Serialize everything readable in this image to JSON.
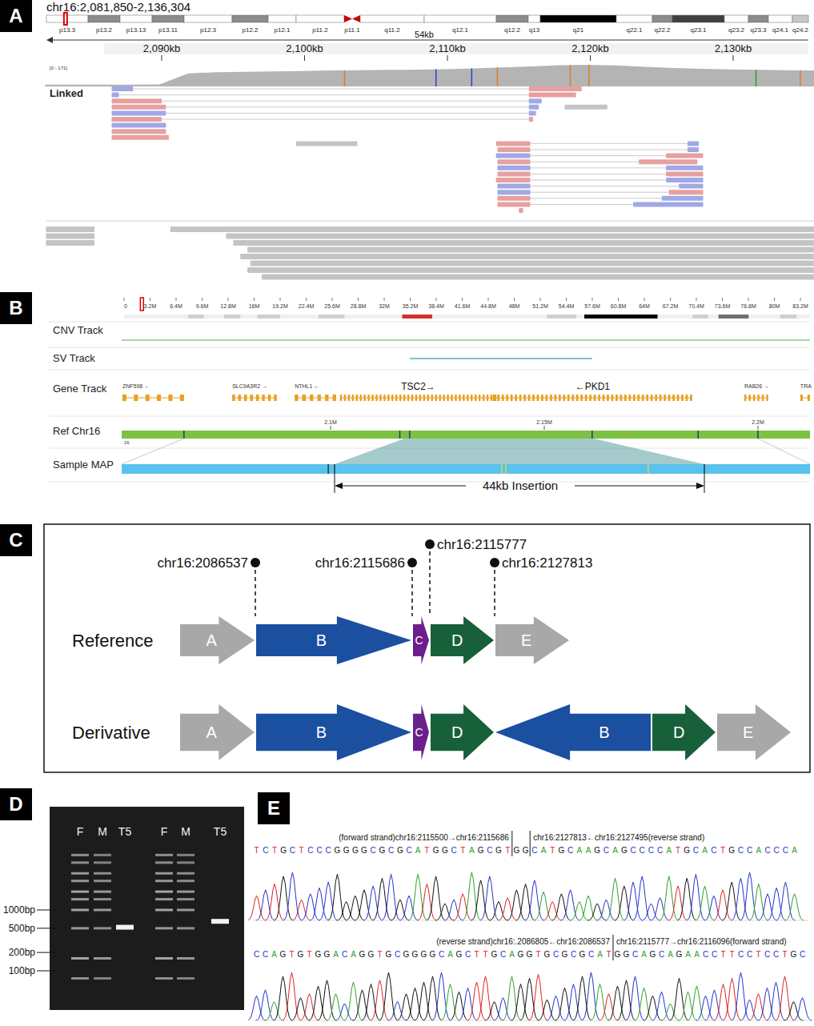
{
  "panelA": {
    "label": "A",
    "locus": "chr16:2,081,850-2,136,304",
    "cytobands": [
      {
        "label": "p13.3",
        "size": 52,
        "color": "#ffffff",
        "current": true,
        "centromere": false
      },
      {
        "label": "p13.2",
        "size": 40,
        "color": "#8c8c8c",
        "current": false,
        "centromere": false
      },
      {
        "label": "p13.13",
        "size": 40,
        "color": "#ffffff",
        "current": false,
        "centromere": false
      },
      {
        "label": "p13.11",
        "size": 40,
        "color": "#8c8c8c",
        "current": false,
        "centromere": false
      },
      {
        "label": "p12.3",
        "size": 60,
        "color": "#ffffff",
        "current": false,
        "centromere": false
      },
      {
        "label": "p12.2",
        "size": 45,
        "color": "#8c8c8c",
        "current": false,
        "centromere": false
      },
      {
        "label": "p12.1",
        "size": 35,
        "color": "#ffffff",
        "current": false,
        "centromere": false
      },
      {
        "label": "p11.2",
        "size": 60,
        "color": "#ffffff",
        "current": false,
        "centromere": false
      },
      {
        "label": "p11.1",
        "size": 20,
        "color": "#cc0000",
        "current": false,
        "centromere": true
      },
      {
        "label": "q11.2",
        "size": 80,
        "color": "#ffffff",
        "current": false,
        "centromere": false
      },
      {
        "label": "q12.1",
        "size": 90,
        "color": "#ffffff",
        "current": false,
        "centromere": false
      },
      {
        "label": "q12.2",
        "size": 40,
        "color": "#8c8c8c",
        "current": false,
        "centromere": false
      },
      {
        "label": "q13",
        "size": 15,
        "color": "#ffffff",
        "current": false,
        "centromere": false
      },
      {
        "label": "q21",
        "size": 95,
        "color": "#000000",
        "current": false,
        "centromere": false
      },
      {
        "label": "q22.1",
        "size": 45,
        "color": "#ffffff",
        "current": false,
        "centromere": false
      },
      {
        "label": "q22.2",
        "size": 25,
        "color": "#8c8c8c",
        "current": false,
        "centromere": false
      },
      {
        "label": "q23.1",
        "size": 65,
        "color": "#404040",
        "current": false,
        "centromere": false
      },
      {
        "label": "q23.2",
        "size": 30,
        "color": "#ffffff",
        "current": false,
        "centromere": false
      },
      {
        "label": "q23.3",
        "size": 25,
        "color": "#8c8c8c",
        "current": false,
        "centromere": false
      },
      {
        "label": "q24.1",
        "size": 30,
        "color": "#ffffff",
        "current": false,
        "centromere": false
      },
      {
        "label": "q24.2",
        "size": 20,
        "color": "#c8c8c8",
        "current": false,
        "centromere": false
      }
    ],
    "span": "54kb",
    "ticks": [
      {
        "label": "2,090kb",
        "kb": 2090
      },
      {
        "label": "2,100kb",
        "kb": 2100
      },
      {
        "label": "2,110kb",
        "kb": 2110
      },
      {
        "label": "2,120kb",
        "kb": 2120
      },
      {
        "label": "2,130kb",
        "kb": 2130
      }
    ],
    "coverage_range": "[0 - 171]",
    "coverage_max": 171,
    "coverage_start_kb": 2081.85,
    "coverage_step_kb": 2,
    "coverage": [
      14,
      14,
      14,
      14,
      16,
      100,
      108,
      112,
      115,
      118,
      122,
      124,
      126,
      128,
      132,
      138,
      145,
      152,
      162,
      165,
      160,
      150,
      140,
      135,
      130,
      126,
      124,
      122
    ],
    "coverage_marks": [
      {
        "kb": 2102.8,
        "color": "#e07b28"
      },
      {
        "kb": 2109.2,
        "color": "#2c3fd0"
      },
      {
        "kb": 2111.7,
        "color": "#2c3fd0"
      },
      {
        "kb": 2113.5,
        "color": "#e07b28"
      },
      {
        "kb": 2118.6,
        "color": "#e07b28"
      },
      {
        "kb": 2119.9,
        "color": "#e07b28"
      },
      {
        "kb": 2131.6,
        "color": "#2ca02c"
      },
      {
        "kb": 2134.7,
        "color": "#e07b28"
      }
    ],
    "linked_label": "Linked",
    "linked_rows": [
      {
        "linked": true,
        "reads": [
          [
            2086.5,
            2088.0,
            "#a0a8e6"
          ],
          [
            2115.7,
            2119.4,
            "#e6a0a0"
          ]
        ]
      },
      {
        "linked": true,
        "reads": [
          [
            2086.5,
            2087.0,
            "#a0a8e6"
          ],
          [
            2115.7,
            2119.0,
            "#e6a0a0"
          ]
        ]
      },
      {
        "linked": true,
        "reads": [
          [
            2086.5,
            2090.0,
            "#e6a0a0"
          ],
          [
            2115.7,
            2116.6,
            "#a0a8e6"
          ]
        ]
      },
      {
        "linked": true,
        "reads": [
          [
            2086.5,
            2090.3,
            "#e6a0a0"
          ],
          [
            2115.7,
            2116.4,
            "#a0a8e6"
          ],
          [
            2118.2,
            2121.2,
            "#c4c4c4"
          ]
        ]
      },
      {
        "linked": true,
        "reads": [
          [
            2086.5,
            2090.3,
            "#a0a8e6"
          ],
          [
            2115.7,
            2116.2,
            "#a0a8e6"
          ]
        ]
      },
      {
        "linked": true,
        "reads": [
          [
            2086.5,
            2090.0,
            "#e6a0a0"
          ],
          [
            2115.7,
            2116.0,
            "#e6a0a0"
          ]
        ]
      },
      {
        "linked": false,
        "reads": [
          [
            2086.5,
            2090.3,
            "#a0a8e6"
          ]
        ]
      },
      {
        "linked": false,
        "reads": [
          [
            2086.5,
            2090.3,
            "#e6a0a0"
          ]
        ]
      },
      {
        "linked": false,
        "reads": [
          [
            2086.5,
            2090.5,
            "#e6a0a0"
          ]
        ]
      },
      {
        "linked": true,
        "reads": [
          [
            2113.4,
            2115.8,
            "#e6a0a0"
          ],
          [
            2126.8,
            2127.6,
            "#a0a8e6"
          ],
          [
            2099.4,
            2103.7,
            "#c4c4c4"
          ]
        ]
      },
      {
        "linked": true,
        "reads": [
          [
            2113.5,
            2115.8,
            "#e6a0a0"
          ],
          [
            2126.8,
            2127.6,
            "#a0a8e6"
          ]
        ]
      },
      {
        "linked": true,
        "reads": [
          [
            2113.4,
            2115.8,
            "#a0a8e6"
          ],
          [
            2125.3,
            2127.9,
            "#e6a0a0"
          ]
        ]
      },
      {
        "linked": true,
        "reads": [
          [
            2113.5,
            2115.8,
            "#e6a0a0"
          ],
          [
            2123.4,
            2127.5,
            "#e6a0a0"
          ]
        ]
      },
      {
        "linked": true,
        "reads": [
          [
            2113.5,
            2115.8,
            "#a0a8e6"
          ],
          [
            2125.3,
            2127.9,
            "#a0a8e6"
          ]
        ]
      },
      {
        "linked": true,
        "reads": [
          [
            2113.5,
            2115.8,
            "#e6a0a0"
          ],
          [
            2125.3,
            2127.9,
            "#e6a0a0"
          ]
        ]
      },
      {
        "linked": true,
        "reads": [
          [
            2113.4,
            2115.8,
            "#e6a0a0"
          ],
          [
            2125.3,
            2127.9,
            "#a0a8e6"
          ]
        ]
      },
      {
        "linked": true,
        "reads": [
          [
            2113.5,
            2115.8,
            "#a0a8e6"
          ],
          [
            2126.2,
            2127.9,
            "#a0a8e6"
          ]
        ]
      },
      {
        "linked": true,
        "reads": [
          [
            2113.5,
            2115.8,
            "#a0a8e6"
          ],
          [
            2125.5,
            2127.9,
            "#e6a0a0"
          ]
        ]
      },
      {
        "linked": true,
        "reads": [
          [
            2113.5,
            2115.8,
            "#e6a0a0"
          ],
          [
            2125.0,
            2127.9,
            "#a0a8e6"
          ]
        ]
      },
      {
        "linked": true,
        "reads": [
          [
            2113.5,
            2115.8,
            "#e6a0a0"
          ],
          [
            2123.0,
            2127.9,
            "#a0a8e6"
          ]
        ]
      },
      {
        "linked": false,
        "reads": [
          [
            2115.0,
            2115.3,
            "#e6a0a0"
          ]
        ]
      }
    ],
    "other_color": "#c4c4c4",
    "other_rows": [
      [
        [
          2081.9,
          2085.3
        ],
        [
          2090.6,
          2136.3
        ]
      ],
      [
        [
          2081.9,
          2085.3
        ],
        [
          2094.5,
          2136.3
        ]
      ],
      [
        [
          2081.9,
          2085.3
        ],
        [
          2095.0,
          2136.3
        ]
      ],
      [
        [
          2096.0,
          2136.3
        ]
      ],
      [
        [
          2095.5,
          2136.3
        ]
      ],
      [
        [
          2096.2,
          2136.3
        ]
      ],
      [
        [
          2096.0,
          2136.3
        ]
      ],
      [
        [
          2097.0,
          2136.3
        ]
      ]
    ]
  },
  "panelB": {
    "label": "B",
    "ruler": [
      "0",
      "3.2M",
      "6.4M",
      "9.6M",
      "12.8M",
      "16M",
      "19.2M",
      "22.4M",
      "25.6M",
      "28.8M",
      "32M",
      "35.2M",
      "38.4M",
      "41.6M",
      "44.8M",
      "48M",
      "51.2M",
      "54.4M",
      "57.6M",
      "60.8M",
      "64M",
      "67.2M",
      "70.4M",
      "73.6M",
      "76.8M",
      "80M",
      "83.2M"
    ],
    "ruler_marker_mb": 2.0,
    "cytobands": [
      {
        "start": 7.9,
        "end": 9.8,
        "color": "#cfcfcf"
      },
      {
        "start": 12.3,
        "end": 14.3,
        "color": "#cfcfcf"
      },
      {
        "start": 16.4,
        "end": 19.2,
        "color": "#cfcfcf"
      },
      {
        "start": 23.9,
        "end": 27.1,
        "color": "#cfcfcf"
      },
      {
        "start": 34.2,
        "end": 37.9,
        "color": "#d43030"
      },
      {
        "start": 52.0,
        "end": 55.6,
        "color": "#cfcfcf"
      },
      {
        "start": 56.6,
        "end": 65.6,
        "color": "#000000"
      },
      {
        "start": 69.9,
        "end": 71.8,
        "color": "#cfcfcf"
      },
      {
        "start": 73.1,
        "end": 76.8,
        "color": "#707070"
      },
      {
        "start": 80.7,
        "end": 82.7,
        "color": "#cfcfcf"
      }
    ],
    "tracks": [
      "CNV Track",
      "SV Track",
      "Gene Track",
      "Ref Chr16",
      "Sample MAP"
    ],
    "sv": {
      "start": 2118.5,
      "end": 2161.2
    },
    "genes": [
      {
        "label": "ZNF598 ←",
        "start": 2051.3,
        "end": 2065.7,
        "exons": 6,
        "kind": "minor"
      },
      {
        "label": "SLC9A3R2 →",
        "start": 2077.0,
        "end": 2087.4,
        "exons": 8,
        "kind": "minor"
      },
      {
        "label": "NTHL1 ←",
        "start": 2091.6,
        "end": 2101.3,
        "exons": 6,
        "kind": "minor"
      },
      {
        "label": "TSC2→",
        "start": 2102.2,
        "end": 2138.8,
        "exons": 40,
        "kind": "major"
      },
      {
        "label": "←PKD1",
        "start": 2138.0,
        "end": 2184.6,
        "exons": 46,
        "kind": "major"
      },
      {
        "label": "RAB26 →",
        "start": 2196.8,
        "end": 2202.4,
        "exons": 6,
        "kind": "minor"
      },
      {
        "label": "TRA",
        "start": 2209.9,
        "end": 2212.2,
        "exons": 2,
        "kind": "minor"
      }
    ],
    "ref_ticks": [
      {
        "label": "2.1M",
        "kb": 2100
      },
      {
        "label": "2.15M",
        "kb": 2150
      },
      {
        "label": "2.2M",
        "kb": 2200
      }
    ],
    "ref_marks": [
      2065.7,
      2116.2,
      2118.5,
      2161.2,
      2186.0,
      2200.0
    ],
    "chrom": "16",
    "insertion": {
      "ref_start": 2117.2,
      "ref_end": 2161.6,
      "label": "44kb Insertion"
    },
    "sample_marks": [
      {
        "at": -0.017,
        "color": "#333333"
      },
      {
        "at": 0.0,
        "color": "#333333"
      },
      {
        "at": 0.452,
        "color": "#e8d040"
      },
      {
        "at": 0.463,
        "color": "#e8d040"
      },
      {
        "at": 0.848,
        "color": "#e8d040"
      },
      {
        "at": 1.0,
        "color": "#333333"
      }
    ]
  },
  "panelC": {
    "label": "C",
    "breakpoints": [
      "chr16:2086537",
      "chr16:2115686",
      "chr16:2115777",
      "chr16:2127813"
    ],
    "segments": [
      {
        "letter": "A",
        "color": "#a8a8a8",
        "size": 93
      },
      {
        "letter": "B",
        "color": "#1b4fa0",
        "size": 194
      },
      {
        "letter": "C",
        "color": "#6b1f8c",
        "size": 20
      },
      {
        "letter": "D",
        "color": "#17603a",
        "size": 79
      },
      {
        "letter": "E",
        "color": "#a8a8a8",
        "size": 92
      }
    ],
    "reference": {
      "label": "Reference",
      "order": [
        {
          "letter": "A",
          "reverse": false
        },
        {
          "letter": "B",
          "reverse": false
        },
        {
          "letter": "C",
          "reverse": false
        },
        {
          "letter": "D",
          "reverse": false
        },
        {
          "letter": "E",
          "reverse": false
        }
      ]
    },
    "derivative": {
      "label": "Derivative",
      "order": [
        {
          "letter": "A",
          "reverse": false
        },
        {
          "letter": "B",
          "reverse": false
        },
        {
          "letter": "C",
          "reverse": false
        },
        {
          "letter": "D",
          "reverse": false
        },
        {
          "letter": "B",
          "reverse": true
        },
        {
          "letter": "D",
          "reverse": false
        },
        {
          "letter": "E",
          "reverse": false
        }
      ]
    }
  },
  "panelD": {
    "label": "D",
    "markers": [
      {
        "label": "1000bp",
        "bp": 1000
      },
      {
        "label": "500bp",
        "bp": 500
      },
      {
        "label": "200bp",
        "bp": 200
      },
      {
        "label": "100bp",
        "bp": 100
      }
    ],
    "lanes": [
      {
        "label": "F",
        "bands": [
          [
            8000,
            0.5
          ],
          [
            6000,
            0.5
          ],
          [
            4000,
            0.55
          ],
          [
            3000,
            0.55
          ],
          [
            2000,
            0.6
          ],
          [
            1500,
            0.55
          ],
          [
            1000,
            0.6
          ],
          [
            500,
            0.55
          ],
          [
            160,
            0.6
          ],
          [
            75,
            0.5
          ]
        ]
      },
      {
        "label": "M",
        "bands": [
          [
            8000,
            0.45
          ],
          [
            6000,
            0.45
          ],
          [
            4000,
            0.5
          ],
          [
            3000,
            0.5
          ],
          [
            2000,
            0.55
          ],
          [
            1500,
            0.5
          ],
          [
            1000,
            0.55
          ],
          [
            500,
            0.5
          ],
          [
            160,
            0.55
          ],
          [
            75,
            0.45
          ]
        ]
      },
      {
        "label": "T5",
        "bands": [
          [
            520,
            0.95
          ]
        ]
      },
      {
        "label": "F",
        "bands": [
          [
            8000,
            0.5
          ],
          [
            6000,
            0.5
          ],
          [
            4000,
            0.55
          ],
          [
            3000,
            0.55
          ],
          [
            2000,
            0.6
          ],
          [
            1500,
            0.55
          ],
          [
            1000,
            0.6
          ],
          [
            500,
            0.55
          ],
          [
            160,
            0.6
          ],
          [
            75,
            0.5
          ]
        ]
      },
      {
        "label": "M",
        "bands": [
          [
            8000,
            0.45
          ],
          [
            6000,
            0.45
          ],
          [
            4000,
            0.5
          ],
          [
            3000,
            0.5
          ],
          [
            2000,
            0.55
          ],
          [
            1500,
            0.5
          ],
          [
            1000,
            0.55
          ],
          [
            500,
            0.5
          ],
          [
            160,
            0.55
          ],
          [
            75,
            0.45
          ]
        ]
      },
      {
        "label": "T5",
        "bands": [
          [
            650,
            0.95
          ]
        ]
      }
    ]
  },
  "panelE": {
    "label": "E",
    "base_colors": {
      "A": "#2ca02c",
      "C": "#2233cc",
      "G": "#111111",
      "T": "#dd2222"
    },
    "traces": [
      {
        "headers": [
          "(forward strand)chr16:2115500→chr16:2115686",
          "chr16:2127813←chr16:2127495(reverse strand)"
        ],
        "parts": [
          "TCTGCTCCCGGGGCGCGCATGGCTAGCGT",
          "GG",
          "CATGCAAGCAGCCCCATGCACTGCCACCCA"
        ]
      },
      {
        "headers": [
          "(reverse strand)chr16:.2086805←chr16:2086537",
          "chr16:2115777→chr16:2116096(forward strand)"
        ],
        "parts": [
          "CCAGTGTGGACAGGTGCGGGGCAGCTTGCAGGTGCGCGCAT",
          "GGCAGCAGAACCTTCCTCCTGC"
        ]
      }
    ]
  }
}
